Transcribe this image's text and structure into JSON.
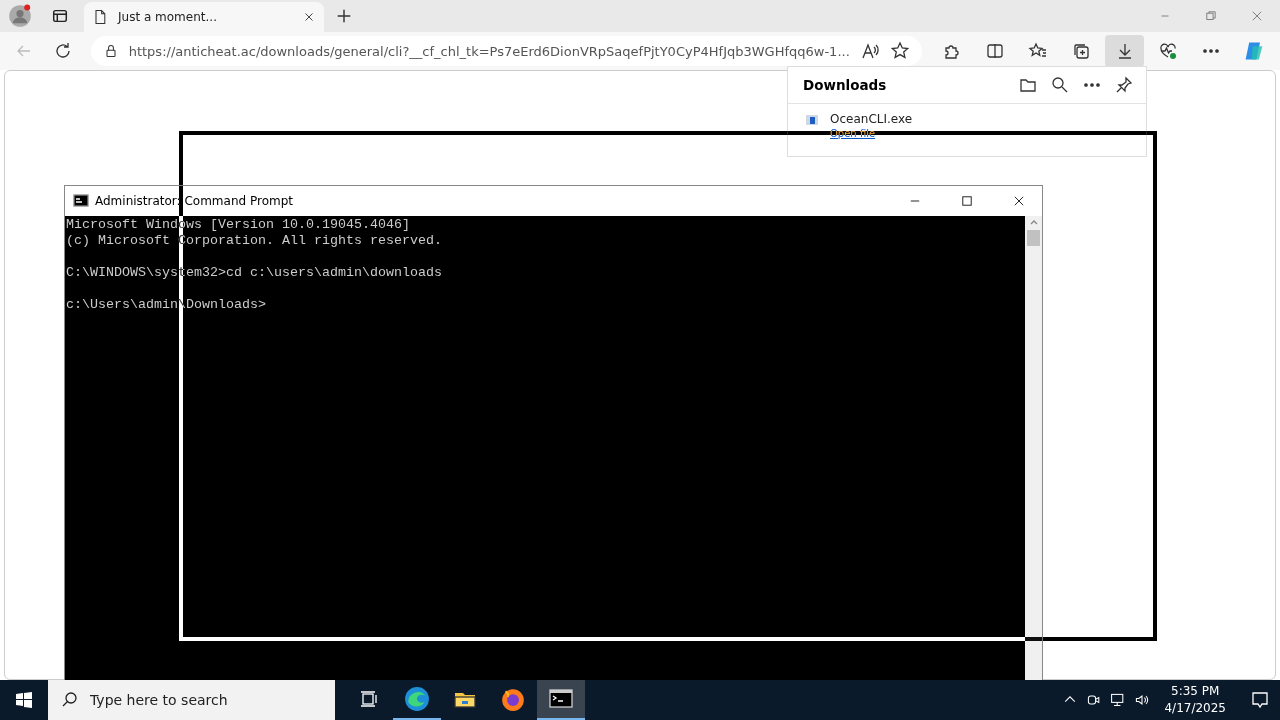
{
  "browser": {
    "tabs": [
      {
        "title": "Just a moment...",
        "selected": true
      }
    ],
    "address": "https://anticheat.ac/downloads/general/cli?__cf_chl_tk=Ps7eErd6DionVRpSaqefPjtY0CyP4HfJqb3WGHfqq6w-1...",
    "toolbar": [
      {
        "kind": "extensions",
        "selected": false
      },
      {
        "kind": "split",
        "selected": false
      },
      {
        "kind": "favorites",
        "selected": false
      },
      {
        "kind": "collections",
        "selected": false
      },
      {
        "kind": "downloads",
        "selected": true
      },
      {
        "kind": "health",
        "selected": false
      },
      {
        "kind": "more",
        "selected": false
      },
      {
        "kind": "copilot",
        "selected": false
      }
    ],
    "downloads_panel": {
      "title": "Downloads",
      "items": [
        {
          "file": "OceanCLI.exe",
          "action": "Open file"
        }
      ]
    }
  },
  "console_window": {
    "title": "Administrator: Command Prompt",
    "blocks": [
      [
        "Microsoft Windows [Version 10.0.19045.4046]",
        "(c) Microsoft Corporation. All rights reserved."
      ],
      [
        "C:\\WINDOWS\\system32>cd c:\\users\\admin\\downloads"
      ],
      [
        "c:\\Users\\admin\\Downloads>"
      ]
    ]
  },
  "taskbar": {
    "search_placeholder": "Type here to search",
    "apps": [
      {
        "kind": "taskview",
        "selected": false,
        "running": false
      },
      {
        "kind": "edge",
        "selected": false,
        "running": true
      },
      {
        "kind": "explorer",
        "selected": false,
        "running": false
      },
      {
        "kind": "firefox",
        "selected": false,
        "running": false
      },
      {
        "kind": "terminal",
        "selected": true,
        "running": true
      }
    ],
    "time": "5:35 PM",
    "date": "4/17/2025"
  }
}
